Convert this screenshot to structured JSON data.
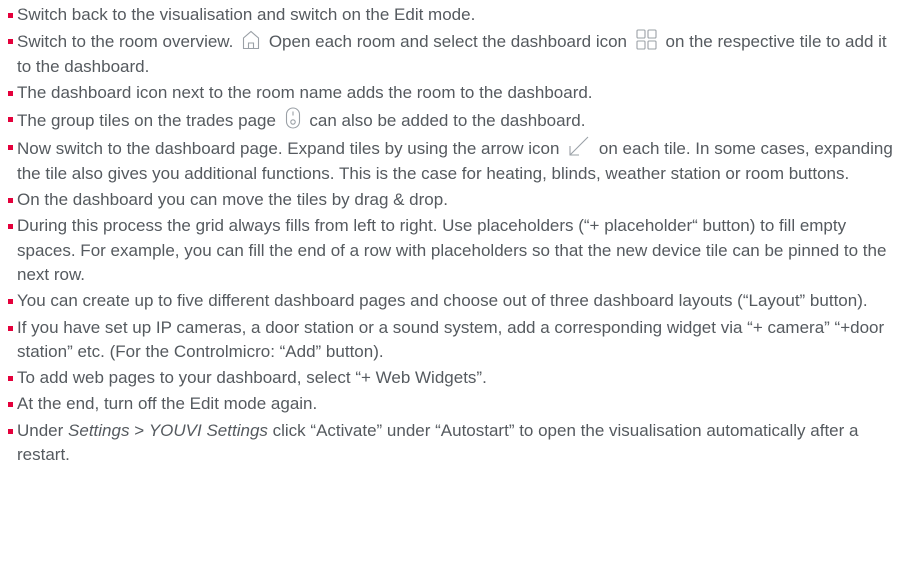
{
  "colors": {
    "bullet": "#e4003b",
    "text": "#555a5f",
    "icon_stroke": "#9aa0a6"
  },
  "steps": [
    {
      "text": "Switch back to the visualisation and switch on the Edit mode."
    },
    {
      "before_home": "Switch to the room overview.",
      "home_icon": "home-icon",
      "middle": " Open each room and select the dashboard icon",
      "dashboard_icon": "dashboard-grid-icon",
      "after": "on the respective tile to add it to the dashboard."
    },
    {
      "text": "The dashboard icon next to the room name adds the room to the dashboard."
    },
    {
      "before": "The group tiles on the trades page",
      "icon": "switch-icon",
      "after": "can also be added to the dashboard."
    },
    {
      "before": "Now switch to the dashboard page. Expand tiles by using the arrow icon",
      "icon": "expand-arrow-icon",
      "after": "on each tile. In some cases, expanding the tile also gives you additional functions. This is the case for heating, blinds, weather station or room buttons."
    },
    {
      "text": "On the dashboard you can move the tiles by drag & drop."
    },
    {
      "text": "During this process the grid always fills from left to right. Use placeholders (“+ placeholder“ button) to fill empty spaces. For example, you can fill the end of a row with placeholders so that the new device tile can be pinned to the next row."
    },
    {
      "text": "You can create up to five different dashboard pages and choose out of three dashboard layouts (“Layout” button)."
    },
    {
      "text": "If you have set up IP cameras, a door station or a sound system, add a corresponding widget via “+ camera” “+door station” etc. (For the Controlmicro: “Add” button)."
    },
    {
      "text": "To add web pages to your dashboard, select “+ Web Widgets”."
    },
    {
      "text": "At the end, turn off the Edit mode again."
    },
    {
      "before": "Under ",
      "em1": "Settings",
      "sep": " > ",
      "em2": "YOUVI Settings",
      "after": " click “Activate” under “Autostart” to open the visualisation automatically after a restart."
    }
  ]
}
